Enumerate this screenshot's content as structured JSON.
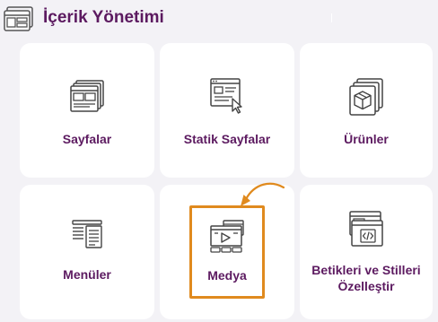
{
  "header": {
    "title": "İçerik Yönetimi",
    "icon": "window-layout-icon"
  },
  "cards": [
    {
      "label": "Sayfalar",
      "icon": "pages-stack-icon"
    },
    {
      "label": "Statik Sayfalar",
      "icon": "static-page-cursor-icon"
    },
    {
      "label": "Ürünler",
      "icon": "product-box-icon"
    },
    {
      "label": "Menüler",
      "icon": "menu-list-icon"
    },
    {
      "label": "Medya",
      "icon": "media-player-icon"
    },
    {
      "label": "Betikleri ve Stilleri Özelleştir",
      "icon": "code-window-icon"
    }
  ],
  "colors": {
    "title": "#5c1a60",
    "highlight": "#e08a1e",
    "background": "#f3f2f6",
    "card": "#ffffff",
    "icon": "#444444"
  }
}
